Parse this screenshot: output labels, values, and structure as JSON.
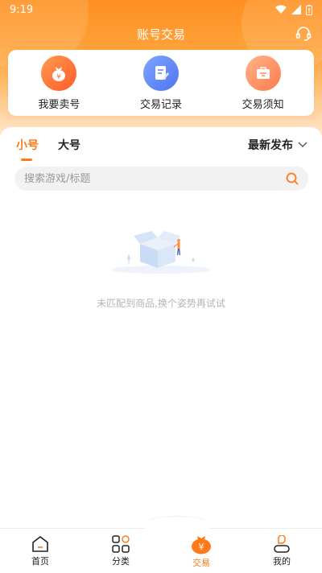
{
  "status_bar": {
    "time": "9:19"
  },
  "header": {
    "title": "账号交易"
  },
  "quick_actions": [
    {
      "label": "我要卖号",
      "icon": "money-bag-icon"
    },
    {
      "label": "交易记录",
      "icon": "record-document-icon"
    },
    {
      "label": "交易须知",
      "icon": "notice-briefcase-icon"
    }
  ],
  "tabs": [
    {
      "label": "小号",
      "active": true
    },
    {
      "label": "大号",
      "active": false
    }
  ],
  "sort": {
    "label": "最新发布"
  },
  "search": {
    "placeholder": "搜索游戏/标题"
  },
  "empty_state": {
    "message": "未匹配到商品,换个姿势再试试"
  },
  "bottom_nav": [
    {
      "label": "首页",
      "icon": "home-icon"
    },
    {
      "label": "分类",
      "icon": "category-icon"
    },
    {
      "label": "交易",
      "icon": "trade-icon",
      "active": true
    },
    {
      "label": "我的",
      "icon": "profile-icon"
    }
  ],
  "colors": {
    "accent": "#ff7a1a",
    "header_gradient_top": "#ff8f1f",
    "empty_text": "#b5b5b5"
  }
}
